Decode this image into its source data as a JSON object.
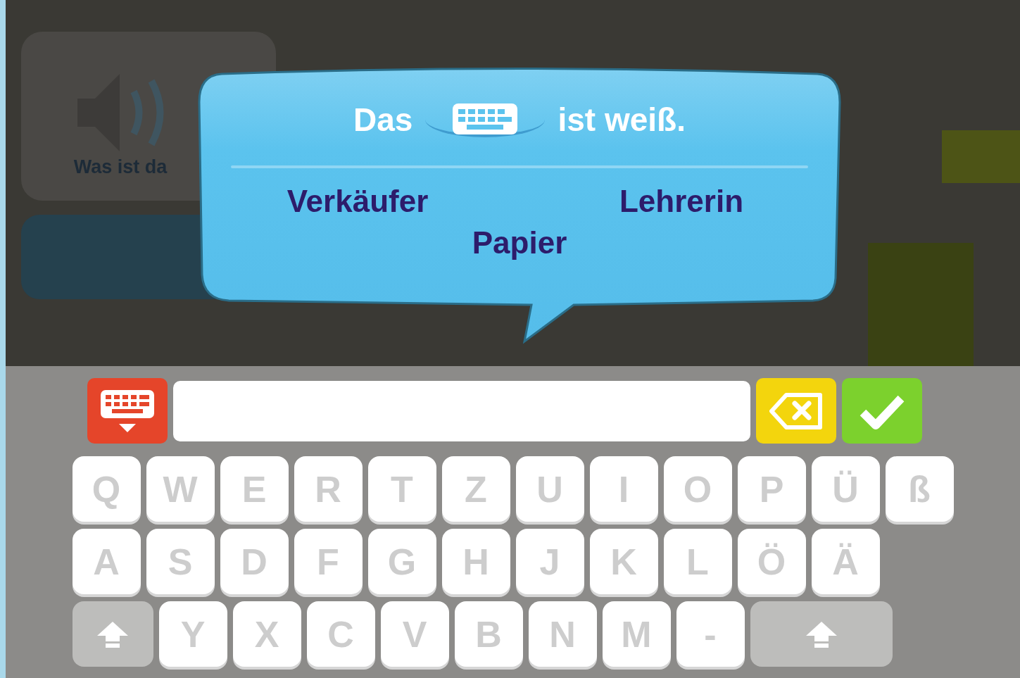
{
  "scene": {
    "prompt_panel": {
      "title": "Was ist da"
    }
  },
  "question": {
    "before": "Das",
    "after": "ist weiß.",
    "options": [
      {
        "label": "Verkäufer"
      },
      {
        "label": "Lehrerin"
      },
      {
        "label": "Papier"
      }
    ]
  },
  "keyboard": {
    "rows": [
      [
        {
          "kind": "letter",
          "label": "Q"
        },
        {
          "kind": "letter",
          "label": "W"
        },
        {
          "kind": "letter",
          "label": "E"
        },
        {
          "kind": "letter",
          "label": "R"
        },
        {
          "kind": "letter",
          "label": "T"
        },
        {
          "kind": "letter",
          "label": "Z"
        },
        {
          "kind": "letter",
          "label": "U"
        },
        {
          "kind": "letter",
          "label": "I"
        },
        {
          "kind": "letter",
          "label": "O"
        },
        {
          "kind": "letter",
          "label": "P"
        },
        {
          "kind": "letter",
          "label": "Ü"
        },
        {
          "kind": "letter",
          "label": "ß"
        }
      ],
      [
        {
          "kind": "letter",
          "label": "A"
        },
        {
          "kind": "letter",
          "label": "S"
        },
        {
          "kind": "letter",
          "label": "D"
        },
        {
          "kind": "letter",
          "label": "F"
        },
        {
          "kind": "letter",
          "label": "G"
        },
        {
          "kind": "letter",
          "label": "H"
        },
        {
          "kind": "letter",
          "label": "J"
        },
        {
          "kind": "letter",
          "label": "K"
        },
        {
          "kind": "letter",
          "label": "L"
        },
        {
          "kind": "letter",
          "label": "Ö"
        },
        {
          "kind": "letter",
          "label": "Ä"
        }
      ],
      [
        {
          "kind": "shift"
        },
        {
          "kind": "letter",
          "label": "Y"
        },
        {
          "kind": "letter",
          "label": "X"
        },
        {
          "kind": "letter",
          "label": "C"
        },
        {
          "kind": "letter",
          "label": "V"
        },
        {
          "kind": "letter",
          "label": "B"
        },
        {
          "kind": "letter",
          "label": "N"
        },
        {
          "kind": "letter",
          "label": "M"
        },
        {
          "kind": "letter",
          "label": "-"
        },
        {
          "kind": "wideshift"
        }
      ]
    ]
  }
}
